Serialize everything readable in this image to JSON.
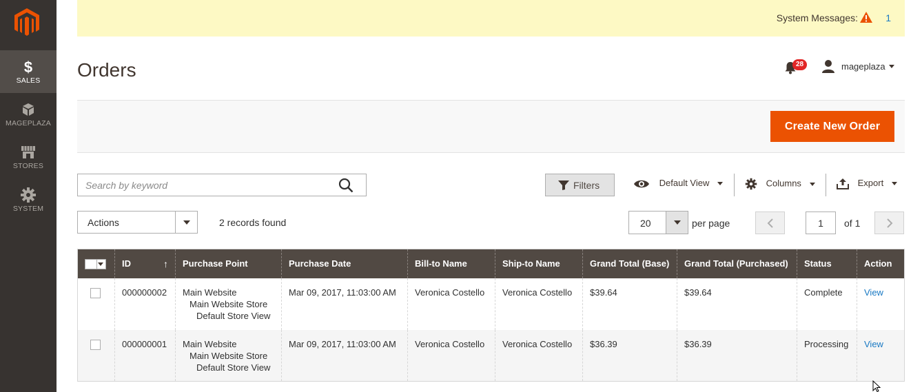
{
  "sidebar": {
    "logo": "magento-logo",
    "items": [
      {
        "label": "SALES",
        "icon": "dollar-icon",
        "active": true
      },
      {
        "label": "MAGEPLAZA",
        "icon": "box-icon",
        "active": false
      },
      {
        "label": "STORES",
        "icon": "store-icon",
        "active": false
      },
      {
        "label": "SYSTEM",
        "icon": "gear-icon",
        "active": false
      }
    ]
  },
  "messages": {
    "label": "System Messages:",
    "count": "1"
  },
  "page": {
    "title": "Orders"
  },
  "header": {
    "notifications": "28",
    "user": "mageplaza"
  },
  "actions": {
    "create_order": "Create New Order"
  },
  "toolbar": {
    "search_placeholder": "Search by keyword",
    "filters": "Filters",
    "view": "Default View",
    "columns": "Columns",
    "export": "Export",
    "mass_actions": "Actions",
    "records": "2 records found",
    "per_page_value": "20",
    "per_page_label": "per page",
    "page_value": "1",
    "page_of": "of 1"
  },
  "table": {
    "columns": [
      "ID",
      "Purchase Point",
      "Purchase Date",
      "Bill-to Name",
      "Ship-to Name",
      "Grand Total (Base)",
      "Grand Total (Purchased)",
      "Status",
      "Action"
    ],
    "sort_indicator": "↑",
    "rows": [
      {
        "id": "000000002",
        "purchase_point": [
          "Main Website",
          "Main Website Store",
          "Default Store View"
        ],
        "date": "Mar 09, 2017, 11:03:00 AM",
        "bill_to": "Veronica Costello",
        "ship_to": "Veronica Costello",
        "total_base": "$39.64",
        "total_purchased": "$39.64",
        "status": "Complete",
        "action": "View"
      },
      {
        "id": "000000001",
        "purchase_point": [
          "Main Website",
          "Main Website Store",
          "Default Store View"
        ],
        "date": "Mar 09, 2017, 11:03:00 AM",
        "bill_to": "Veronica Costello",
        "ship_to": "Veronica Costello",
        "total_base": "$36.39",
        "total_purchased": "$36.39",
        "status": "Processing",
        "action": "View"
      }
    ]
  },
  "colors": {
    "sidebar": "#373330",
    "accent": "#eb5202",
    "table_header": "#514943",
    "link": "#1979c3",
    "message_bar": "#fdf9c4"
  }
}
